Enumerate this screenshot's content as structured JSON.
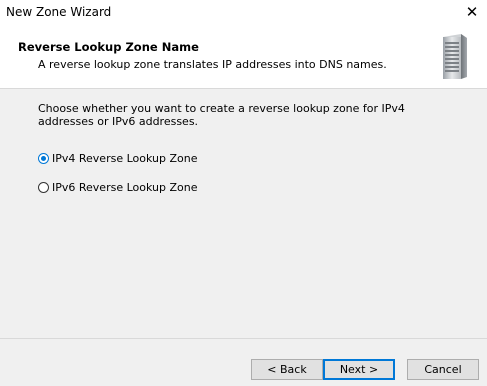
{
  "window": {
    "title": "New Zone Wizard",
    "close_label": "✕"
  },
  "header": {
    "title": "Reverse Lookup Zone Name",
    "subtitle": "A reverse lookup zone translates IP addresses into DNS names.",
    "icon": "server-icon"
  },
  "body": {
    "prompt": "Choose whether you want to create a reverse lookup zone for IPv4 addresses or IPv6 addresses.",
    "options": [
      {
        "label": "IPv4 Reverse Lookup Zone",
        "selected": true
      },
      {
        "label": "IPv6 Reverse Lookup Zone",
        "selected": false
      }
    ]
  },
  "footer": {
    "back_label": "< Back",
    "next_label": "Next >",
    "cancel_label": "Cancel"
  },
  "colors": {
    "accent": "#0078d7",
    "panel_bg": "#f0f0f0"
  }
}
